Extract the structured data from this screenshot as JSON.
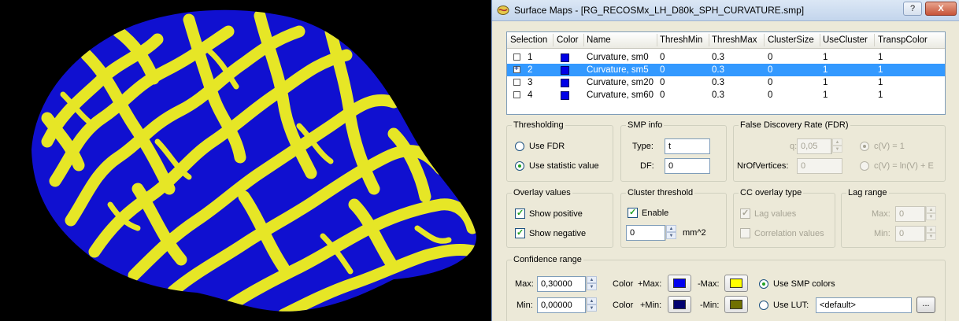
{
  "window": {
    "title": "Surface Maps - [RG_RECOSMx_LH_D80k_SPH_CURVATURE.smp]",
    "help_label": "?",
    "close_label": "X"
  },
  "map_list": {
    "columns": [
      "Selection",
      "Color",
      "Name",
      "ThreshMin",
      "ThreshMax",
      "ClusterSize",
      "UseCluster",
      "TranspColor"
    ],
    "rows": [
      {
        "index": "1",
        "name": "Curvature, sm0",
        "thresh_min": "0",
        "thresh_max": "0.3",
        "cluster_size": "0",
        "use_cluster": "1",
        "transp_color": "1",
        "color": "#0000e6",
        "selected": false
      },
      {
        "index": "2",
        "name": "Curvature, sm5",
        "thresh_min": "0",
        "thresh_max": "0.3",
        "cluster_size": "0",
        "use_cluster": "1",
        "transp_color": "1",
        "color": "#0000e6",
        "selected": true
      },
      {
        "index": "3",
        "name": "Curvature, sm20",
        "thresh_min": "0",
        "thresh_max": "0.3",
        "cluster_size": "0",
        "use_cluster": "1",
        "transp_color": "1",
        "color": "#0000e6",
        "selected": false
      },
      {
        "index": "4",
        "name": "Curvature, sm60",
        "thresh_min": "0",
        "thresh_max": "0.3",
        "cluster_size": "0",
        "use_cluster": "1",
        "transp_color": "1",
        "color": "#0000e6",
        "selected": false
      }
    ]
  },
  "thresholding": {
    "title": "Thresholding",
    "use_fdr_label": "Use FDR",
    "use_statistic_label": "Use statistic value",
    "selected": "use_statistic"
  },
  "smp_info": {
    "title": "SMP info",
    "type_label": "Type:",
    "type_value": "t",
    "df_label": "DF:",
    "df_value": "0"
  },
  "fdr": {
    "title": "False Discovery Rate (FDR)",
    "q_label": "q:",
    "q_value": "0,05",
    "nr_vertices_label": "NrOfVertices:",
    "nr_vertices_value": "0",
    "cv1_label": "c(V) = 1",
    "cvln_label": "c(V) = ln(V) + E"
  },
  "overlay_values": {
    "title": "Overlay values",
    "show_positive_label": "Show positive",
    "show_negative_label": "Show negative",
    "show_positive": true,
    "show_negative": true
  },
  "cluster_threshold": {
    "title": "Cluster threshold",
    "enable_label": "Enable",
    "enabled": true,
    "value": "0",
    "unit": "mm^2"
  },
  "cc_overlay": {
    "title": "CC overlay type",
    "lag_values_label": "Lag values",
    "correlation_values_label": "Correlation values"
  },
  "lag_range": {
    "title": "Lag range",
    "max_label": "Max:",
    "max_value": "0",
    "min_label": "Min:",
    "min_value": "0"
  },
  "confidence_range": {
    "title": "Confidence range",
    "max_label": "Max:",
    "max_value": "0,30000",
    "min_label": "Min:",
    "min_value": "0,00000",
    "color_label": "Color",
    "plus_max_label": "+Max:",
    "minus_max_label": "-Max:",
    "plus_min_label": "+Min:",
    "minus_min_label": "-Min:",
    "plus_max_color": "#0000ee",
    "minus_max_color": "#ffff00",
    "plus_min_color": "#000070",
    "minus_min_color": "#707000",
    "use_smp_colors_label": "Use SMP colors",
    "use_lut_label": "Use LUT:",
    "lut_value": "<default>",
    "browse_label": "..."
  },
  "colors": {
    "gyri": "#e6e626",
    "sulci": "#1010d0"
  }
}
